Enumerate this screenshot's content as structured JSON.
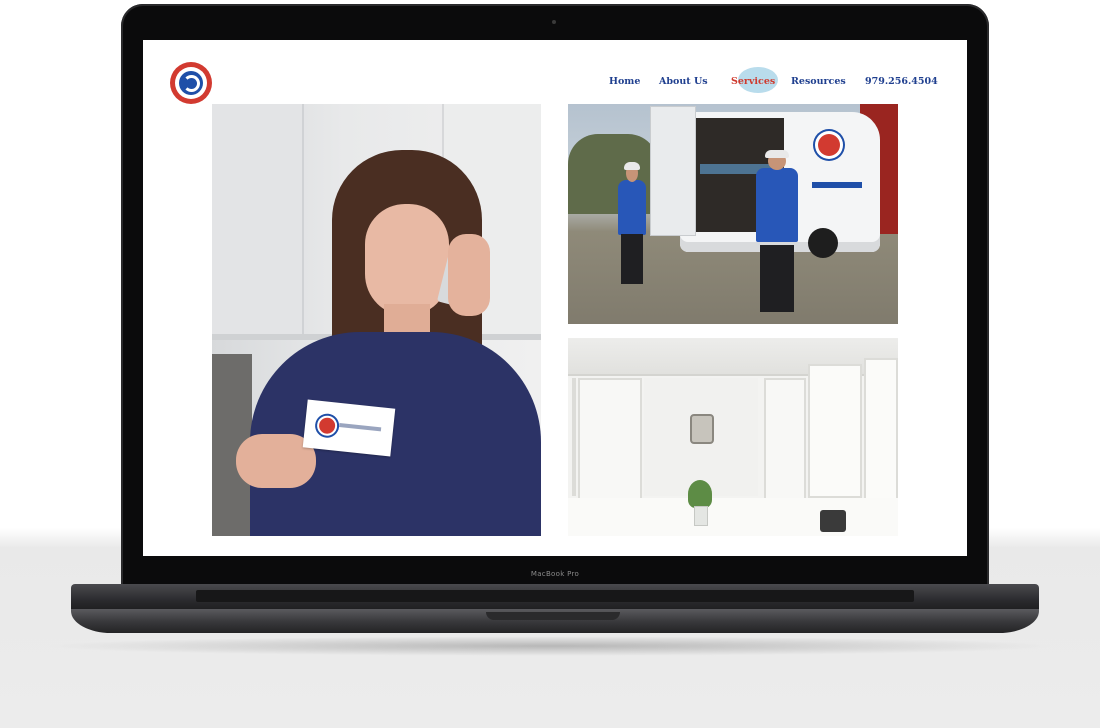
{
  "device": {
    "model_label": "MacBook Pro"
  },
  "site": {
    "logo_icon": "djs-logo-icon",
    "brand_colors": {
      "red": "#d23a30",
      "blue": "#1f4fa8",
      "nav_active_bg": "#b9dcec"
    },
    "nav": {
      "items": [
        {
          "label": "Home",
          "active": false
        },
        {
          "label": "About Us",
          "active": false
        },
        {
          "label": "Services",
          "active": true
        },
        {
          "label": "Resources",
          "active": false
        }
      ],
      "phone": "979.256.4504"
    }
  },
  "gallery": {
    "images": [
      {
        "name": "woman-on-phone-with-business-card-photo"
      },
      {
        "name": "technicians-at-service-van-photo"
      },
      {
        "name": "white-kitchen-cabinets-photo"
      }
    ]
  }
}
